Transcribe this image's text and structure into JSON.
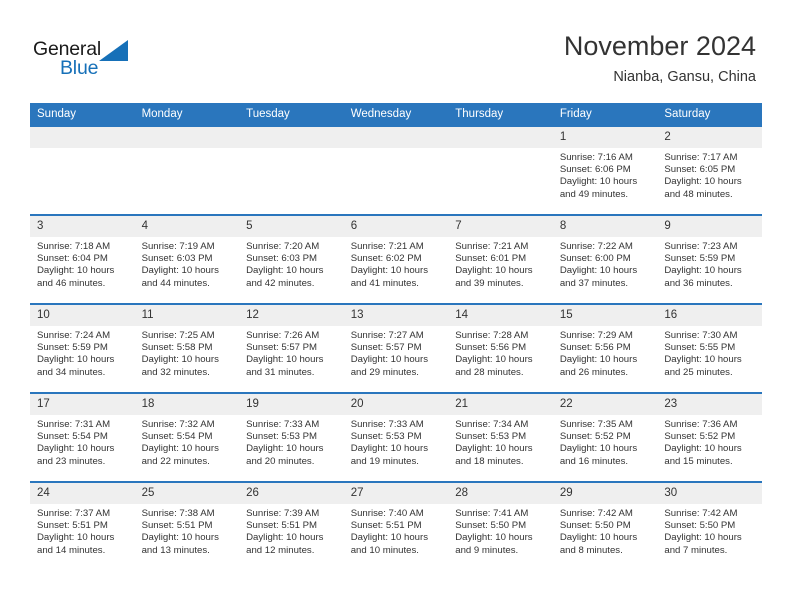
{
  "brand": {
    "name_part1": "General",
    "name_part2": "Blue",
    "triangle_icon": "blue-triangle-icon",
    "accent_color": "#1670b8"
  },
  "header": {
    "title": "November 2024",
    "subtitle": "Nianba, Gansu, China"
  },
  "theme": {
    "header_blue": "#2a76bd",
    "daynum_gray": "#efefef",
    "text": "#333333"
  },
  "calendar": {
    "weekday_headers": [
      "Sunday",
      "Monday",
      "Tuesday",
      "Wednesday",
      "Thursday",
      "Friday",
      "Saturday"
    ],
    "weeks": [
      [
        {
          "day": "",
          "sunrise": "",
          "sunset": "",
          "daylight": ""
        },
        {
          "day": "",
          "sunrise": "",
          "sunset": "",
          "daylight": ""
        },
        {
          "day": "",
          "sunrise": "",
          "sunset": "",
          "daylight": ""
        },
        {
          "day": "",
          "sunrise": "",
          "sunset": "",
          "daylight": ""
        },
        {
          "day": "",
          "sunrise": "",
          "sunset": "",
          "daylight": ""
        },
        {
          "day": "1",
          "sunrise": "Sunrise: 7:16 AM",
          "sunset": "Sunset: 6:06 PM",
          "daylight": "Daylight: 10 hours and 49 minutes."
        },
        {
          "day": "2",
          "sunrise": "Sunrise: 7:17 AM",
          "sunset": "Sunset: 6:05 PM",
          "daylight": "Daylight: 10 hours and 48 minutes."
        }
      ],
      [
        {
          "day": "3",
          "sunrise": "Sunrise: 7:18 AM",
          "sunset": "Sunset: 6:04 PM",
          "daylight": "Daylight: 10 hours and 46 minutes."
        },
        {
          "day": "4",
          "sunrise": "Sunrise: 7:19 AM",
          "sunset": "Sunset: 6:03 PM",
          "daylight": "Daylight: 10 hours and 44 minutes."
        },
        {
          "day": "5",
          "sunrise": "Sunrise: 7:20 AM",
          "sunset": "Sunset: 6:03 PM",
          "daylight": "Daylight: 10 hours and 42 minutes."
        },
        {
          "day": "6",
          "sunrise": "Sunrise: 7:21 AM",
          "sunset": "Sunset: 6:02 PM",
          "daylight": "Daylight: 10 hours and 41 minutes."
        },
        {
          "day": "7",
          "sunrise": "Sunrise: 7:21 AM",
          "sunset": "Sunset: 6:01 PM",
          "daylight": "Daylight: 10 hours and 39 minutes."
        },
        {
          "day": "8",
          "sunrise": "Sunrise: 7:22 AM",
          "sunset": "Sunset: 6:00 PM",
          "daylight": "Daylight: 10 hours and 37 minutes."
        },
        {
          "day": "9",
          "sunrise": "Sunrise: 7:23 AM",
          "sunset": "Sunset: 5:59 PM",
          "daylight": "Daylight: 10 hours and 36 minutes."
        }
      ],
      [
        {
          "day": "10",
          "sunrise": "Sunrise: 7:24 AM",
          "sunset": "Sunset: 5:59 PM",
          "daylight": "Daylight: 10 hours and 34 minutes."
        },
        {
          "day": "11",
          "sunrise": "Sunrise: 7:25 AM",
          "sunset": "Sunset: 5:58 PM",
          "daylight": "Daylight: 10 hours and 32 minutes."
        },
        {
          "day": "12",
          "sunrise": "Sunrise: 7:26 AM",
          "sunset": "Sunset: 5:57 PM",
          "daylight": "Daylight: 10 hours and 31 minutes."
        },
        {
          "day": "13",
          "sunrise": "Sunrise: 7:27 AM",
          "sunset": "Sunset: 5:57 PM",
          "daylight": "Daylight: 10 hours and 29 minutes."
        },
        {
          "day": "14",
          "sunrise": "Sunrise: 7:28 AM",
          "sunset": "Sunset: 5:56 PM",
          "daylight": "Daylight: 10 hours and 28 minutes."
        },
        {
          "day": "15",
          "sunrise": "Sunrise: 7:29 AM",
          "sunset": "Sunset: 5:56 PM",
          "daylight": "Daylight: 10 hours and 26 minutes."
        },
        {
          "day": "16",
          "sunrise": "Sunrise: 7:30 AM",
          "sunset": "Sunset: 5:55 PM",
          "daylight": "Daylight: 10 hours and 25 minutes."
        }
      ],
      [
        {
          "day": "17",
          "sunrise": "Sunrise: 7:31 AM",
          "sunset": "Sunset: 5:54 PM",
          "daylight": "Daylight: 10 hours and 23 minutes."
        },
        {
          "day": "18",
          "sunrise": "Sunrise: 7:32 AM",
          "sunset": "Sunset: 5:54 PM",
          "daylight": "Daylight: 10 hours and 22 minutes."
        },
        {
          "day": "19",
          "sunrise": "Sunrise: 7:33 AM",
          "sunset": "Sunset: 5:53 PM",
          "daylight": "Daylight: 10 hours and 20 minutes."
        },
        {
          "day": "20",
          "sunrise": "Sunrise: 7:33 AM",
          "sunset": "Sunset: 5:53 PM",
          "daylight": "Daylight: 10 hours and 19 minutes."
        },
        {
          "day": "21",
          "sunrise": "Sunrise: 7:34 AM",
          "sunset": "Sunset: 5:53 PM",
          "daylight": "Daylight: 10 hours and 18 minutes."
        },
        {
          "day": "22",
          "sunrise": "Sunrise: 7:35 AM",
          "sunset": "Sunset: 5:52 PM",
          "daylight": "Daylight: 10 hours and 16 minutes."
        },
        {
          "day": "23",
          "sunrise": "Sunrise: 7:36 AM",
          "sunset": "Sunset: 5:52 PM",
          "daylight": "Daylight: 10 hours and 15 minutes."
        }
      ],
      [
        {
          "day": "24",
          "sunrise": "Sunrise: 7:37 AM",
          "sunset": "Sunset: 5:51 PM",
          "daylight": "Daylight: 10 hours and 14 minutes."
        },
        {
          "day": "25",
          "sunrise": "Sunrise: 7:38 AM",
          "sunset": "Sunset: 5:51 PM",
          "daylight": "Daylight: 10 hours and 13 minutes."
        },
        {
          "day": "26",
          "sunrise": "Sunrise: 7:39 AM",
          "sunset": "Sunset: 5:51 PM",
          "daylight": "Daylight: 10 hours and 12 minutes."
        },
        {
          "day": "27",
          "sunrise": "Sunrise: 7:40 AM",
          "sunset": "Sunset: 5:51 PM",
          "daylight": "Daylight: 10 hours and 10 minutes."
        },
        {
          "day": "28",
          "sunrise": "Sunrise: 7:41 AM",
          "sunset": "Sunset: 5:50 PM",
          "daylight": "Daylight: 10 hours and 9 minutes."
        },
        {
          "day": "29",
          "sunrise": "Sunrise: 7:42 AM",
          "sunset": "Sunset: 5:50 PM",
          "daylight": "Daylight: 10 hours and 8 minutes."
        },
        {
          "day": "30",
          "sunrise": "Sunrise: 7:42 AM",
          "sunset": "Sunset: 5:50 PM",
          "daylight": "Daylight: 10 hours and 7 minutes."
        }
      ]
    ]
  }
}
